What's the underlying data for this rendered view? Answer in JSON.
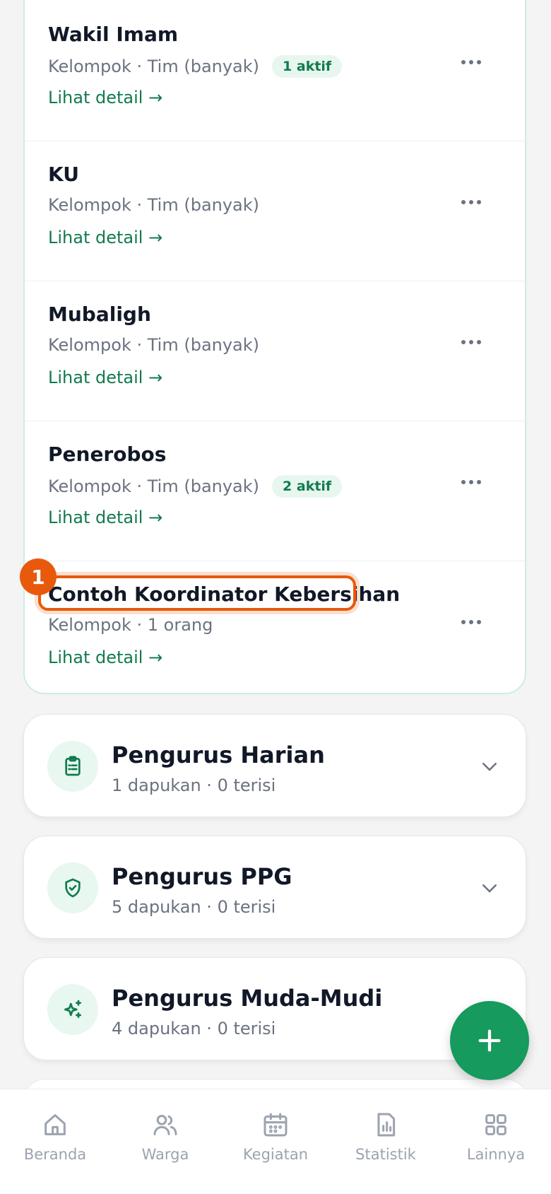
{
  "items": [
    {
      "name": "Wakil Imam",
      "meta": "Kelompok · Tim (banyak)",
      "badge": "1 aktif",
      "detail": "Lihat detail →"
    },
    {
      "name": "KU",
      "meta": "Kelompok · Tim (banyak)",
      "badge": "",
      "detail": "Lihat detail →"
    },
    {
      "name": "Mubaligh",
      "meta": "Kelompok · Tim (banyak)",
      "badge": "",
      "detail": "Lihat detail →"
    },
    {
      "name": "Penerobos",
      "meta": "Kelompok · Tim (banyak)",
      "badge": "2 aktif",
      "detail": "Lihat detail →"
    },
    {
      "name": "Contoh Koordinator Kebersihan",
      "meta": "Kelompok · 1 orang",
      "badge": "",
      "detail": "Lihat detail →"
    }
  ],
  "marker": "1",
  "sections": [
    {
      "title": "Pengurus Harian",
      "sub": "1 dapukan · 0 terisi",
      "icon": "clipboard-icon"
    },
    {
      "title": "Pengurus PPG",
      "sub": "5 dapukan · 0 terisi",
      "icon": "shield-check-icon"
    },
    {
      "title": "Pengurus Muda-Mudi",
      "sub": "4 dapukan · 0 terisi",
      "icon": "sparkles-icon"
    }
  ],
  "nav": [
    {
      "label": "Beranda",
      "icon": "home-icon"
    },
    {
      "label": "Warga",
      "icon": "users-icon"
    },
    {
      "label": "Kegiatan",
      "icon": "calendar-icon"
    },
    {
      "label": "Statistik",
      "icon": "chart-icon"
    },
    {
      "label": "Lainnya",
      "icon": "grid-icon"
    }
  ],
  "colors": {
    "accent": "#169a5d",
    "highlight": "#e8590c",
    "text_green": "#137a4e"
  }
}
